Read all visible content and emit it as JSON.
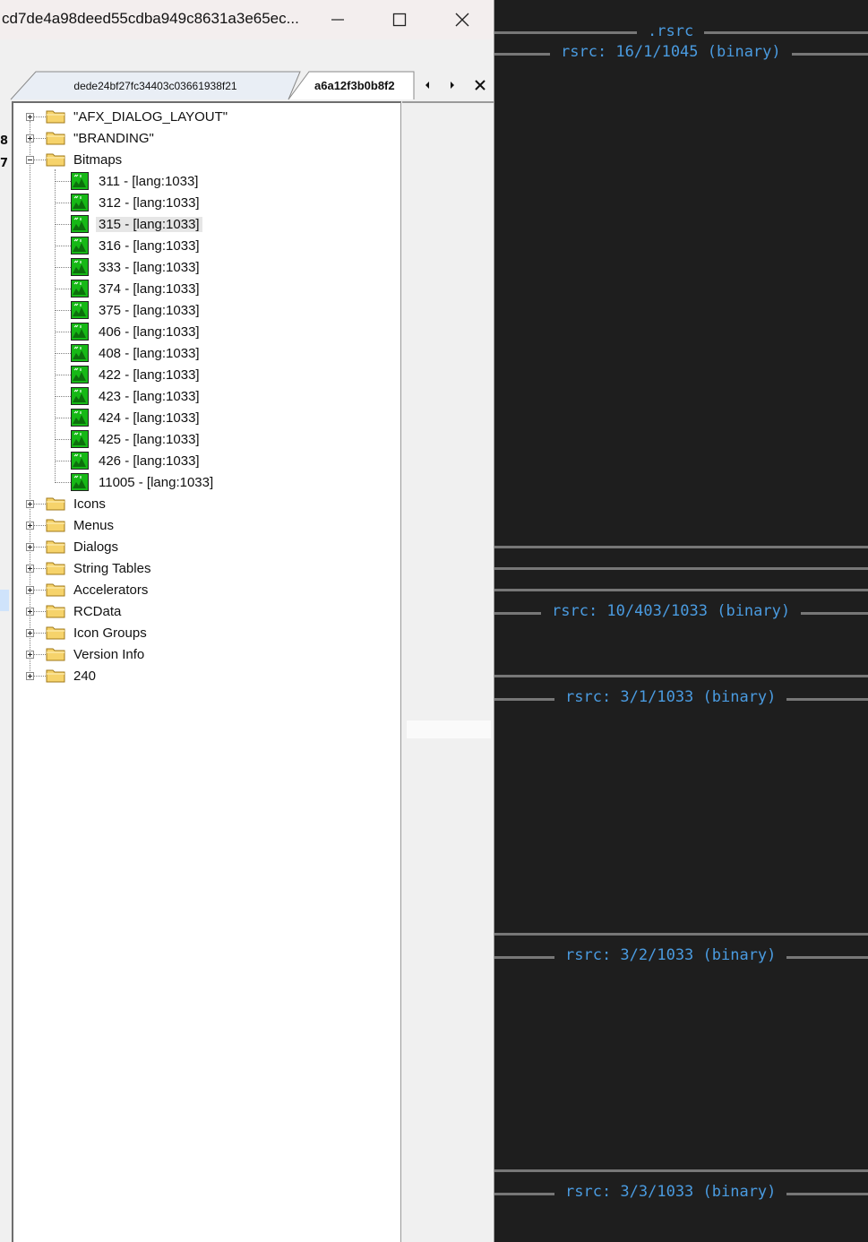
{
  "window": {
    "title": "cd7de4a98deed55cdba949c8631a3e65ec...",
    "controls": {
      "minimize": "minimize",
      "maximize": "maximize",
      "close": "close"
    }
  },
  "tabs": [
    {
      "label": "dede24bf27fc34403c03661938f21"
    },
    {
      "label": "a6a12f3b0b8f2"
    }
  ],
  "left_edge": {
    "char1": "8",
    "char2": "7"
  },
  "tree": {
    "roots_before": [
      {
        "label": "\"AFX_DIALOG_LAYOUT\""
      },
      {
        "label": "\"BRANDING\""
      }
    ],
    "bitmaps": {
      "label": "Bitmaps",
      "items": [
        "311 - [lang:1033]",
        "312 - [lang:1033]",
        "315 - [lang:1033]",
        "316 - [lang:1033]",
        "333 - [lang:1033]",
        "374 - [lang:1033]",
        "375 - [lang:1033]",
        "406 - [lang:1033]",
        "408 - [lang:1033]",
        "422 - [lang:1033]",
        "423 - [lang:1033]",
        "424 - [lang:1033]",
        "425 - [lang:1033]",
        "426 - [lang:1033]",
        "11005 - [lang:1033]"
      ],
      "selected": "315 - [lang:1033]"
    },
    "roots_after": [
      {
        "label": "Icons"
      },
      {
        "label": "Menus"
      },
      {
        "label": "Dialogs"
      },
      {
        "label": "String Tables"
      },
      {
        "label": "Accelerators"
      },
      {
        "label": "RCData"
      },
      {
        "label": "Icon Groups"
      },
      {
        "label": "Version Info"
      },
      {
        "label": "240"
      }
    ]
  },
  "sections": {
    "top": ".rsrc",
    "labels": [
      "rsrc: 16/1/1045 (binary)",
      "rsrc: 10/403/1033 (binary)",
      "rsrc: 3/1/1033 (binary)",
      "rsrc: 3/2/1033 (binary)",
      "rsrc: 3/3/1033 (binary)"
    ]
  },
  "colors": {
    "accent_text": "#4a9be0",
    "dark_bg": "#1e1e1e",
    "rule": "#777777",
    "bitmap_icon": "#16b816"
  }
}
